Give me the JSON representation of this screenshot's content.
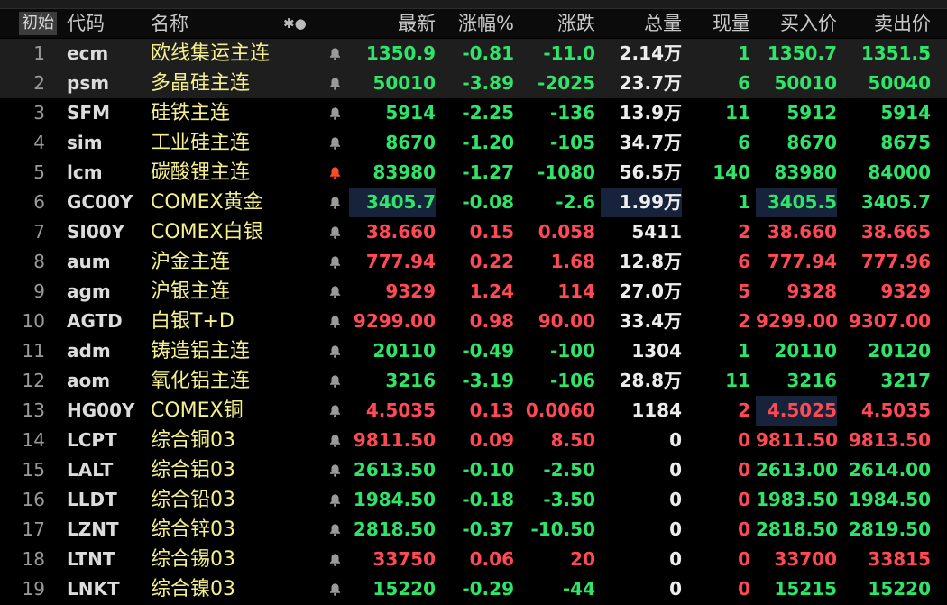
{
  "header": {
    "init_label": "初始",
    "code": "代码",
    "name": "名称",
    "icons": "✱●",
    "last": "最新",
    "pct": "涨幅%",
    "chg": "涨跌",
    "vol": "总量",
    "cur": "现量",
    "bid": "买入价",
    "ask": "卖出价"
  },
  "rows": [
    {
      "n": "1",
      "code": "ecm",
      "name": "欧线集运主连",
      "last": "1350.9",
      "pct": "-0.81",
      "chg": "-11.0",
      "vol": "2.14万",
      "cur": "1",
      "bid": "1350.7",
      "ask": "1351.5"
    },
    {
      "n": "2",
      "code": "psm",
      "name": "多晶硅主连",
      "last": "50010",
      "pct": "-3.89",
      "chg": "-2025",
      "vol": "23.7万",
      "cur": "6",
      "bid": "50010",
      "ask": "50040"
    },
    {
      "n": "3",
      "code": "SFM",
      "name": "硅铁主连",
      "last": "5914",
      "pct": "-2.25",
      "chg": "-136",
      "vol": "13.9万",
      "cur": "11",
      "bid": "5912",
      "ask": "5914"
    },
    {
      "n": "4",
      "code": "sim",
      "name": "工业硅主连",
      "last": "8670",
      "pct": "-1.20",
      "chg": "-105",
      "vol": "34.7万",
      "cur": "6",
      "bid": "8670",
      "ask": "8675"
    },
    {
      "n": "5",
      "code": "lcm",
      "name": "碳酸锂主连",
      "last": "83980",
      "pct": "-1.27",
      "chg": "-1080",
      "vol": "56.5万",
      "cur": "140",
      "bid": "83980",
      "ask": "84000"
    },
    {
      "n": "6",
      "code": "GC00Y",
      "name": "COMEX黄金",
      "last": "3405.7",
      "pct": "-0.08",
      "chg": "-2.6",
      "vol": "1.99万",
      "cur": "1",
      "bid": "3405.5",
      "ask": "3405.7"
    },
    {
      "n": "7",
      "code": "SI00Y",
      "name": "COMEX白银",
      "last": "38.660",
      "pct": "0.15",
      "chg": "0.058",
      "vol": "5411",
      "cur": "2",
      "bid": "38.660",
      "ask": "38.665"
    },
    {
      "n": "8",
      "code": "aum",
      "name": "沪金主连",
      "last": "777.94",
      "pct": "0.22",
      "chg": "1.68",
      "vol": "12.8万",
      "cur": "6",
      "bid": "777.94",
      "ask": "777.96"
    },
    {
      "n": "9",
      "code": "agm",
      "name": "沪银主连",
      "last": "9329",
      "pct": "1.24",
      "chg": "114",
      "vol": "27.0万",
      "cur": "5",
      "bid": "9328",
      "ask": "9329"
    },
    {
      "n": "10",
      "code": "AGTD",
      "name": "白银T+D",
      "last": "9299.00",
      "pct": "0.98",
      "chg": "90.00",
      "vol": "33.4万",
      "cur": "2",
      "bid": "9299.00",
      "ask": "9307.00"
    },
    {
      "n": "11",
      "code": "adm",
      "name": "铸造铝主连",
      "last": "20110",
      "pct": "-0.49",
      "chg": "-100",
      "vol": "1304",
      "cur": "1",
      "bid": "20110",
      "ask": "20120"
    },
    {
      "n": "12",
      "code": "aom",
      "name": "氧化铝主连",
      "last": "3216",
      "pct": "-3.19",
      "chg": "-106",
      "vol": "28.8万",
      "cur": "11",
      "bid": "3216",
      "ask": "3217"
    },
    {
      "n": "13",
      "code": "HG00Y",
      "name": "COMEX铜",
      "last": "4.5035",
      "pct": "0.13",
      "chg": "0.0060",
      "vol": "1184",
      "cur": "2",
      "bid": "4.5025",
      "ask": "4.5035"
    },
    {
      "n": "14",
      "code": "LCPT",
      "name": "综合铜03",
      "last": "9811.50",
      "pct": "0.09",
      "chg": "8.50",
      "vol": "0",
      "cur": "0",
      "bid": "9811.50",
      "ask": "9813.50"
    },
    {
      "n": "15",
      "code": "LALT",
      "name": "综合铝03",
      "last": "2613.50",
      "pct": "-0.10",
      "chg": "-2.50",
      "vol": "0",
      "cur": "0",
      "bid": "2613.00",
      "ask": "2614.00"
    },
    {
      "n": "16",
      "code": "LLDT",
      "name": "综合铅03",
      "last": "1984.50",
      "pct": "-0.18",
      "chg": "-3.50",
      "vol": "0",
      "cur": "0",
      "bid": "1983.50",
      "ask": "1984.50"
    },
    {
      "n": "17",
      "code": "LZNT",
      "name": "综合锌03",
      "last": "2818.50",
      "pct": "-0.37",
      "chg": "-10.50",
      "vol": "0",
      "cur": "0",
      "bid": "2818.50",
      "ask": "2819.50"
    },
    {
      "n": "18",
      "code": "LTNT",
      "name": "综合锡03",
      "last": "33750",
      "pct": "0.06",
      "chg": "20",
      "vol": "0",
      "cur": "0",
      "bid": "33700",
      "ask": "33815"
    },
    {
      "n": "19",
      "code": "LNKT",
      "name": "综合镍03",
      "last": "15220",
      "pct": "-0.29",
      "chg": "-44",
      "vol": "0",
      "cur": "0",
      "bid": "15215",
      "ask": "15220"
    }
  ],
  "colors": {
    "up": "#ff4a56",
    "down": "#2ee56a",
    "neutral": "#ededed",
    "name": "#f5f08c",
    "alert_active": "#ff4a2a"
  },
  "icons": {
    "row_alert": "bell-icon"
  }
}
